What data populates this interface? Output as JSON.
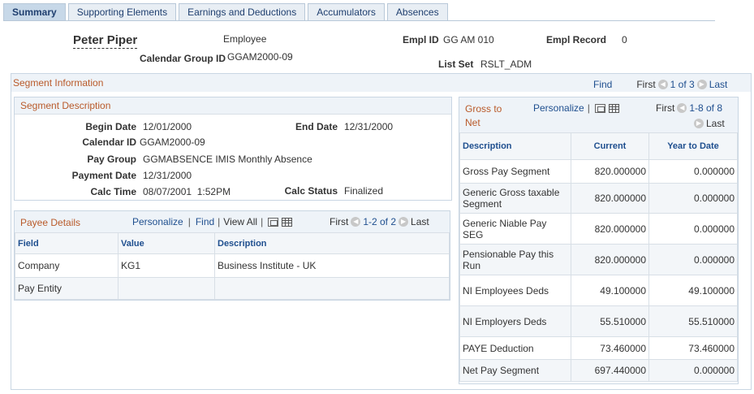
{
  "tabs": [
    {
      "label": "Summary"
    },
    {
      "label": "Supporting Elements"
    },
    {
      "label": "Earnings and Deductions"
    },
    {
      "label": "Accumulators"
    },
    {
      "label": "Absences"
    }
  ],
  "header": {
    "name": "Peter Piper",
    "role": "Employee",
    "empl_id_label": "Empl ID",
    "empl_id": "GG AM 010",
    "empl_record_label": "Empl Record",
    "empl_record": "0",
    "calendar_group_label": "Calendar Group ID",
    "calendar_group": "GGAM2000-09",
    "list_set_label": "List Set",
    "list_set": "RSLT_ADM"
  },
  "segment": {
    "title": "Segment Information",
    "find": "Find",
    "first": "First",
    "count": "1 of 3",
    "last": "Last"
  },
  "segment_desc": {
    "title": "Segment Description",
    "begin_date_label": "Begin Date",
    "begin_date": "12/01/2000",
    "end_date_label": "End Date",
    "end_date": "12/31/2000",
    "calendar_id_label": "Calendar ID",
    "calendar_id": "GGAM2000-09",
    "pay_group_label": "Pay Group",
    "pay_group": "GGMABSENCE IMIS Monthly Absence",
    "payment_date_label": "Payment Date",
    "payment_date": "12/31/2000",
    "calc_time_label": "Calc Time",
    "calc_time": "08/07/2001  1:52PM",
    "calc_status_label": "Calc Status",
    "calc_status": "Finalized"
  },
  "payee": {
    "title": "Payee Details",
    "personalize": "Personalize",
    "find": "Find",
    "view_all": "View All",
    "first": "First",
    "count": "1-2 of 2",
    "last": "Last",
    "columns": [
      "Field",
      "Value",
      "Description"
    ],
    "rows": [
      [
        "Company",
        "KG1",
        "Business Institute - UK"
      ],
      [
        "Pay Entity",
        "",
        ""
      ]
    ]
  },
  "gross": {
    "title_line1": "Gross to",
    "title_line2": "Net",
    "personalize": "Personalize",
    "first": "First",
    "count": "1-8 of 8",
    "last": "Last",
    "columns": [
      "Description",
      "Current",
      "Year to Date"
    ],
    "rows": [
      [
        "Gross Pay Segment",
        "820.000000",
        "0.000000"
      ],
      [
        "Generic Gross taxable Segment",
        "820.000000",
        "0.000000"
      ],
      [
        "Generic Niable Pay SEG",
        "820.000000",
        "0.000000"
      ],
      [
        "Pensionable Pay this Run",
        "820.000000",
        "0.000000"
      ],
      [
        "NI Employees Deds",
        "49.100000",
        "49.100000"
      ],
      [
        "NI Employers Deds",
        "55.510000",
        "55.510000"
      ],
      [
        "PAYE Deduction",
        "73.460000",
        "73.460000"
      ],
      [
        "Net Pay Segment",
        "697.440000",
        "0.000000"
      ]
    ]
  }
}
